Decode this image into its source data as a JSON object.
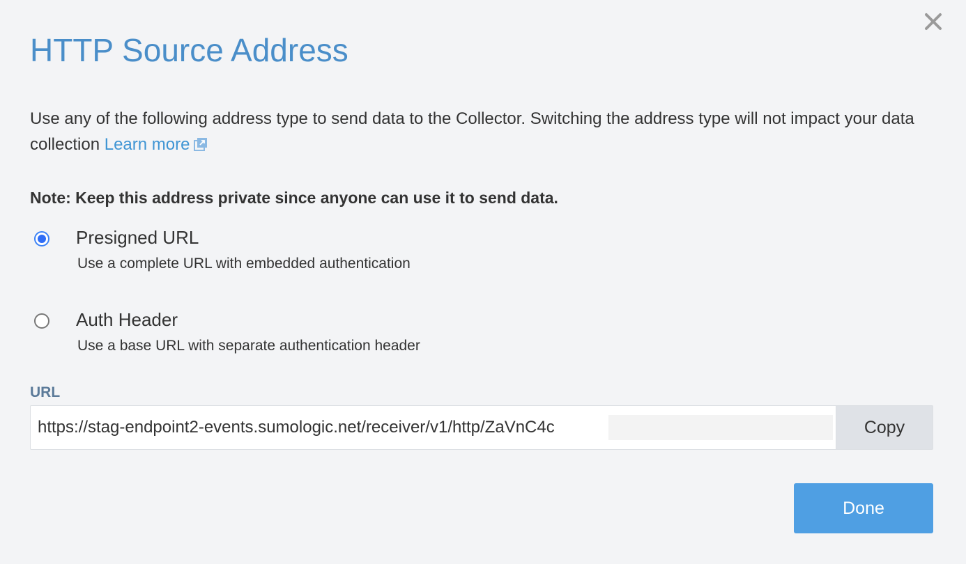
{
  "dialog": {
    "title": "HTTP Source Address",
    "description": "Use any of the following address type to send data to the Collector. Switching the address type will not impact your data collection",
    "learn_more": "Learn more",
    "note": "Note: Keep this address private since anyone can use it to send data.",
    "options": [
      {
        "label": "Presigned URL",
        "description": "Use a complete URL with embedded authentication",
        "checked": true
      },
      {
        "label": "Auth Header",
        "description": "Use a base URL with separate authentication header",
        "checked": false
      }
    ],
    "url_label": "URL",
    "url_value": "https://stag-endpoint2-events.sumologic.net/receiver/v1/http/ZaVnC4c",
    "copy_label": "Copy",
    "done_label": "Done"
  },
  "colors": {
    "title": "#4a8ec9",
    "link": "#3f95d4",
    "radio_checked": "#2f6df6",
    "done_button": "#4f9fe3",
    "background": "#f3f4f6"
  },
  "icons": {
    "close": "close-icon",
    "external_link": "external-link-icon"
  }
}
